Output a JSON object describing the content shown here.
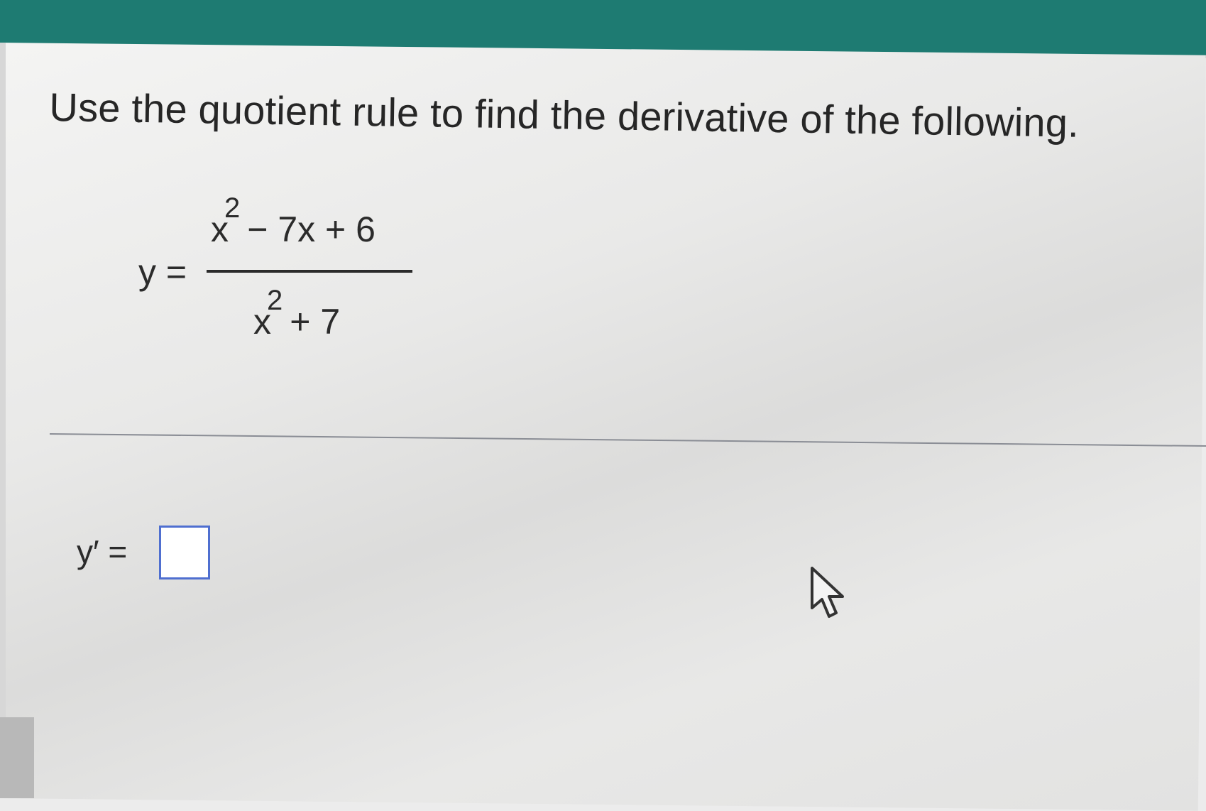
{
  "question": {
    "instruction": "Use the quotient rule to find the derivative of the following.",
    "lhs": "y =",
    "numerator": {
      "base": "x",
      "exponent": "2",
      "rest": "− 7x + 6"
    },
    "denominator": {
      "base": "x",
      "exponent": "2",
      "rest": "+ 7"
    }
  },
  "answer": {
    "label": "y′ =",
    "value": ""
  },
  "icons": {
    "cursor": "mouse-pointer-icon"
  },
  "colors": {
    "top_bar": "#1e7b72",
    "input_border": "#4f6fd0"
  }
}
